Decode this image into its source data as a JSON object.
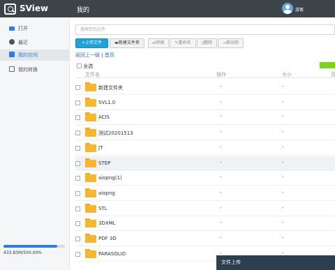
{
  "app": {
    "name": "SView",
    "page_title": "我的",
    "username": "游客"
  },
  "sidebar": {
    "items": [
      {
        "label": "打开",
        "icon": "folder-open-icon"
      },
      {
        "label": "最近",
        "icon": "clock-icon"
      },
      {
        "label": "我的空间",
        "icon": "clipboard-icon",
        "active": true
      },
      {
        "label": "我的转换",
        "icon": "checklist-icon"
      }
    ],
    "storage": {
      "text": "433.83M/500.00%",
      "used_fraction": 0.87
    }
  },
  "search": {
    "placeholder": "搜索您的文件"
  },
  "toolbar": {
    "upload": "上传文件",
    "new_folder": "新建文件夹",
    "convert": "转换",
    "rename": "重命名",
    "delete": "删除",
    "move": "移动到"
  },
  "breadcrumb": {
    "back": "返回上一级",
    "separator": "|",
    "home": "首页"
  },
  "select_all": "全选",
  "table": {
    "headers": {
      "name": "文件名",
      "action": "操作",
      "size": "大小",
      "extra": "另"
    },
    "rows": [
      {
        "name": "新建文件夹",
        "action": "-",
        "size": "-"
      },
      {
        "name": "SVL1.0",
        "action": "-",
        "size": "-"
      },
      {
        "name": "ACIS",
        "action": "-",
        "size": "-"
      },
      {
        "name": "测试20201513",
        "action": "-",
        "size": "-"
      },
      {
        "name": "JT",
        "action": "-",
        "size": "-"
      },
      {
        "name": "STEP",
        "action": "-",
        "size": "-"
      },
      {
        "name": "aiopng(1)",
        "action": "-",
        "size": "-"
      },
      {
        "name": "aiopng",
        "action": "-",
        "size": "-"
      },
      {
        "name": "STL",
        "action": "-",
        "size": "-"
      },
      {
        "name": "3DXML",
        "action": "-",
        "size": "-"
      },
      {
        "name": "PDF 3D",
        "action": "-",
        "size": "-"
      },
      {
        "name": "PARASOLID",
        "action": "-",
        "size": "-"
      }
    ]
  },
  "upload_panel": {
    "title": "文件上传"
  },
  "colors": {
    "topbar": "#3d4449",
    "accent": "#2a7de1",
    "primary_button": "#21a0d6",
    "folder": "#f5b731",
    "green": "#7ed321",
    "upload_panel": "#2c3e50"
  }
}
